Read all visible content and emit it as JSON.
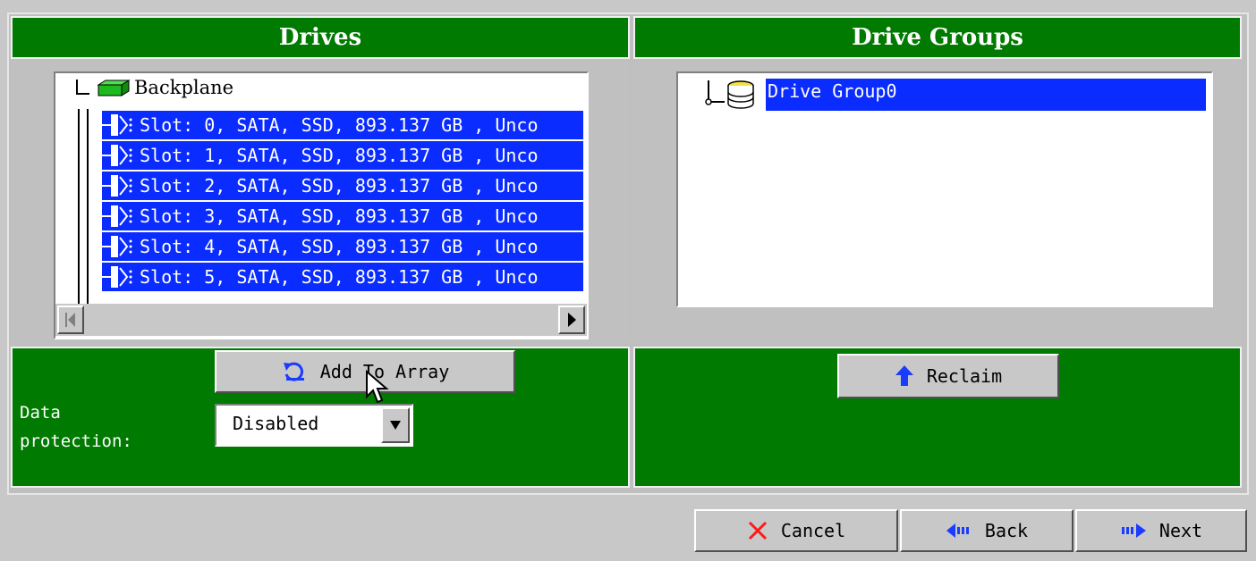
{
  "drives_panel": {
    "title": "Drives",
    "root_label": "Backplane",
    "slots": [
      "Slot: 0, SATA, SSD, 893.137 GB , Unco",
      "Slot: 1, SATA, SSD, 893.137 GB , Unco",
      "Slot: 2, SATA, SSD, 893.137 GB , Unco",
      "Slot: 3, SATA, SSD, 893.137 GB , Unco",
      "Slot: 4, SATA, SSD, 893.137 GB , Unco",
      "Slot: 5, SATA, SSD, 893.137 GB , Unco"
    ]
  },
  "groups_panel": {
    "title": "Drive Groups",
    "group_label": "Drive Group0"
  },
  "actions": {
    "add_to_array": "Add To Array",
    "reclaim": "Reclaim",
    "data_protection_label_1": "Data",
    "data_protection_label_2": "protection:",
    "data_protection_value": "Disabled"
  },
  "footer": {
    "cancel": "Cancel",
    "back": "Back",
    "next": "Next"
  },
  "colors": {
    "header_green": "#007a00",
    "selection_blue": "#0a2cff"
  }
}
